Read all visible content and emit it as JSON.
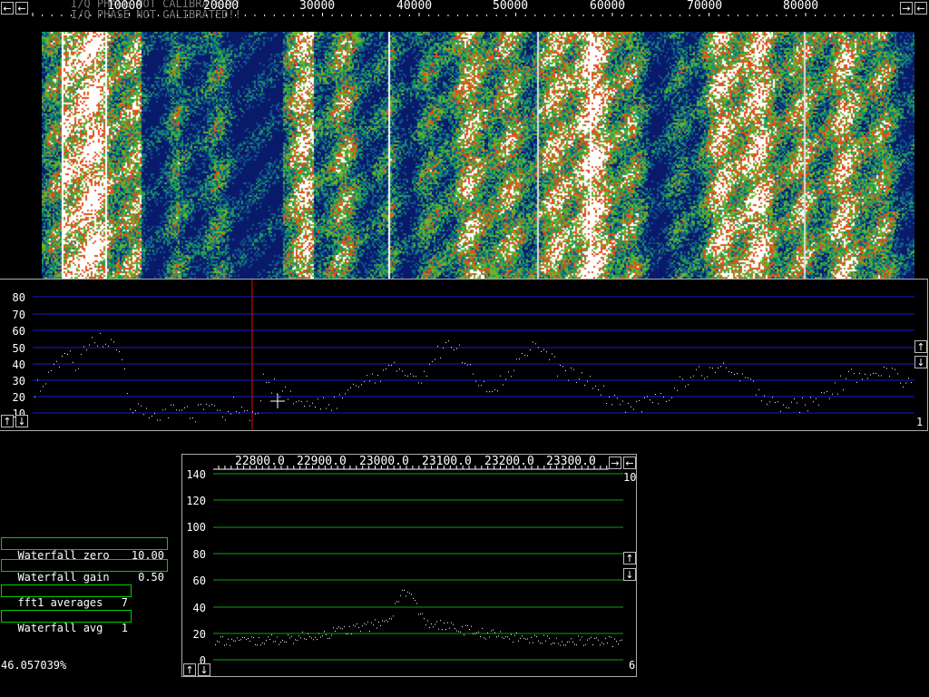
{
  "top_scale": {
    "ghost_text": [
      "I/Q PHASE NOT CALIBRATED!!",
      "I/Q PHASE NOT CALIBRATED!!"
    ],
    "ticks": [
      "10000",
      "20000",
      "30000",
      "40000",
      "50000",
      "60000",
      "70000",
      "80000"
    ],
    "left_arrow": "←",
    "right_arrow": "→",
    "right_arrow2": "←"
  },
  "waterfall": {
    "palette": [
      "#0a1a6a",
      "#0d5a8a",
      "#1a9a5a",
      "#6ab42a",
      "#e0501a",
      "#ffffff"
    ]
  },
  "spectrum": {
    "y_ticks": [
      "80",
      "70",
      "60",
      "50",
      "40",
      "30",
      "20",
      "10"
    ],
    "up_arrow": "↑",
    "down_arrow": "↓",
    "corner_value": "1",
    "grid_color": "#1a1ad0",
    "marker_color": "#d01010"
  },
  "zoom": {
    "x_ticks": [
      "22800.0",
      "22900.0",
      "23000.0",
      "23100.0",
      "23200.0",
      "23300.0"
    ],
    "y_ticks": [
      "140",
      "120",
      "100",
      "80",
      "60",
      "40",
      "20",
      "0"
    ],
    "top_right_value": "10",
    "bottom_right_value": "6",
    "grid_color": "#10a010",
    "right_arrow": "→",
    "left_arrow": "←",
    "up_arrow": "↑",
    "down_arrow": "↓"
  },
  "params": [
    {
      "label": "Waterfall zero",
      "value": "10.00"
    },
    {
      "label": "Waterfall gain",
      "value": "0.50"
    },
    {
      "label": "fft1 averages",
      "value": "7"
    },
    {
      "label": "Waterfall avg",
      "value": "1"
    }
  ],
  "status_percent": "46.057039%"
}
